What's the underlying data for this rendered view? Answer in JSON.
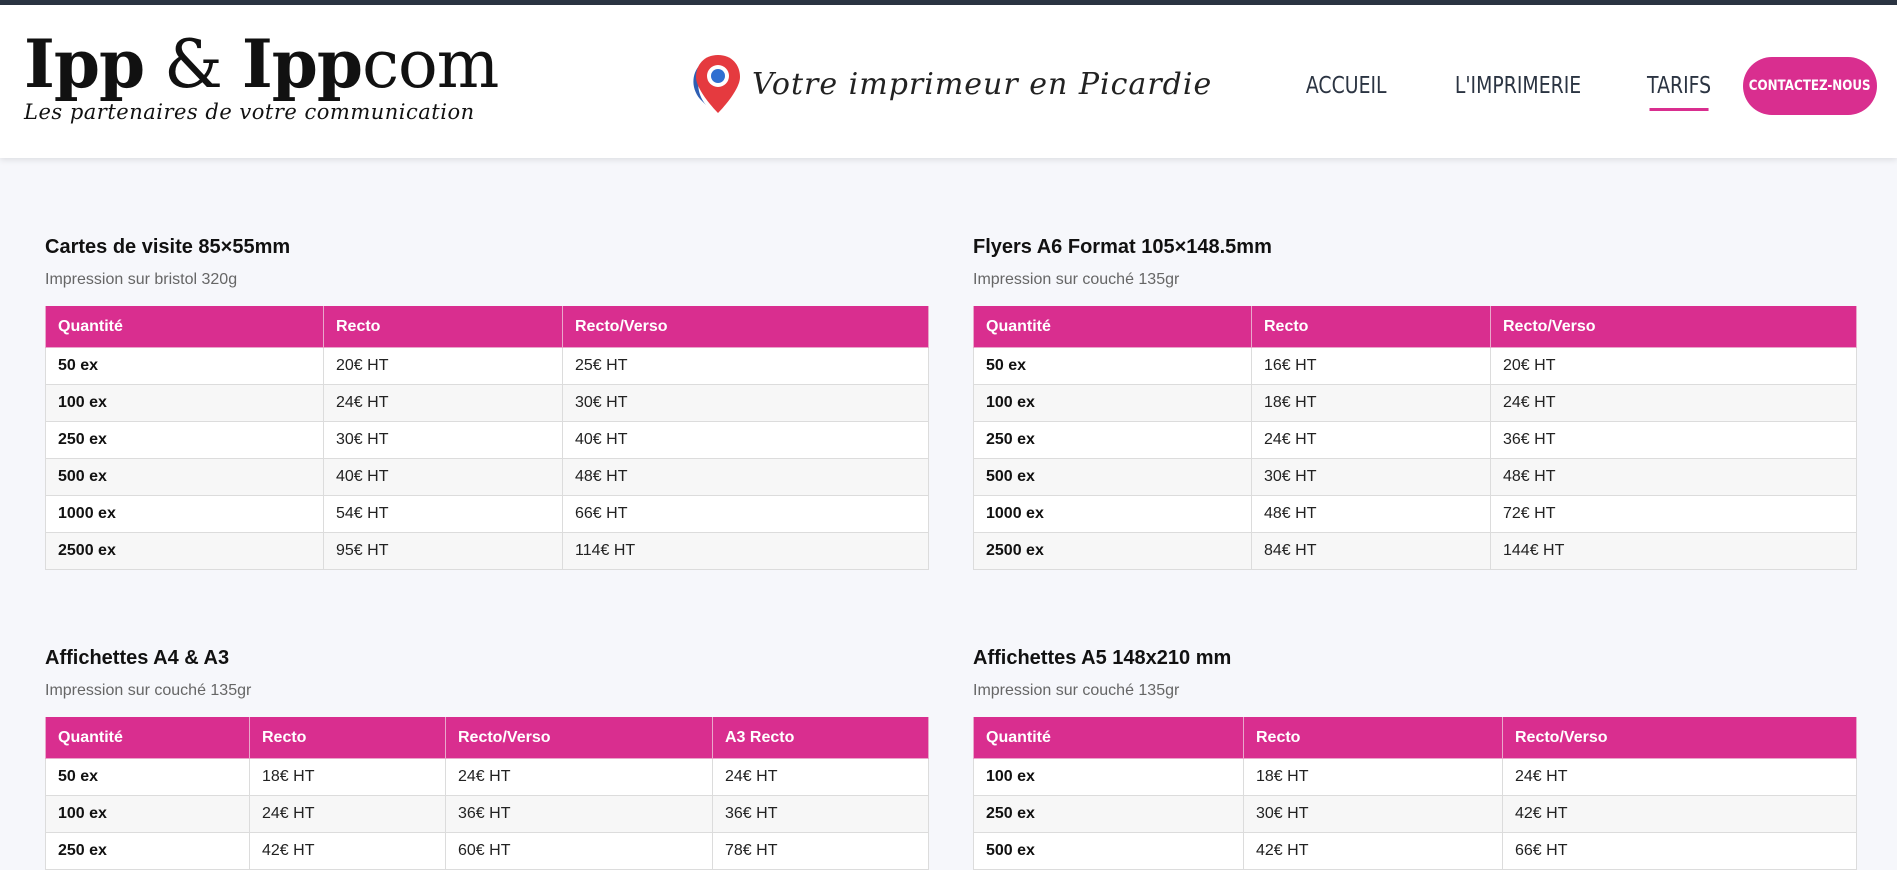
{
  "header": {
    "logo_ipp": "Ipp",
    "logo_amp": "&",
    "logo_ippcom_ipp": "Ipp",
    "logo_ippcom_com": "com",
    "logo_tagline": "Les partenaires de votre communication",
    "slogan": "Votre imprimeur en Picardie",
    "nav": [
      "ACCUEIL",
      "L'IMPRIMERIE",
      "TARIFS"
    ],
    "active_nav": "TARIFS",
    "cta": "CONTACTEZ-NOUS",
    "accent_color": "#d92e8f",
    "icons": {
      "pin": "location-pin-icon"
    }
  },
  "sections": [
    {
      "title": "Cartes de visite 85×55mm",
      "subtitle": "Impression sur bristol 320g",
      "headers": [
        "Quantité",
        "Recto",
        "Recto/Verso"
      ],
      "rows": [
        [
          "50 ex",
          "20€ HT",
          "25€ HT"
        ],
        [
          "100 ex",
          "24€ HT",
          "30€ HT"
        ],
        [
          "250 ex",
          "30€ HT",
          "40€ HT"
        ],
        [
          "500 ex",
          "40€ HT",
          "48€ HT"
        ],
        [
          "1000 ex",
          "54€ HT",
          "66€ HT"
        ],
        [
          "2500 ex",
          "95€ HT",
          "114€ HT"
        ]
      ]
    },
    {
      "title": "Flyers A6 Format 105×148.5mm",
      "subtitle": "Impression sur couché 135gr",
      "headers": [
        "Quantité",
        "Recto",
        "Recto/Verso"
      ],
      "rows": [
        [
          "50 ex",
          "16€ HT",
          "20€ HT"
        ],
        [
          "100 ex",
          "18€ HT",
          "24€ HT"
        ],
        [
          "250 ex",
          "24€ HT",
          "36€ HT"
        ],
        [
          "500 ex",
          "30€ HT",
          "48€ HT"
        ],
        [
          "1000 ex",
          "48€ HT",
          "72€ HT"
        ],
        [
          "2500 ex",
          "84€ HT",
          "144€ HT"
        ]
      ]
    },
    {
      "title": "Affichettes A4 & A3",
      "subtitle": "Impression sur couché 135gr",
      "headers": [
        "Quantité",
        "Recto",
        "Recto/Verso",
        "A3 Recto"
      ],
      "rows": [
        [
          "50 ex",
          "18€ HT",
          "24€ HT",
          "24€ HT"
        ],
        [
          "100 ex",
          "24€ HT",
          "36€ HT",
          "36€ HT"
        ],
        [
          "250 ex",
          "42€ HT",
          "60€ HT",
          "78€ HT"
        ]
      ]
    },
    {
      "title": "Affichettes A5 148x210 mm",
      "subtitle": "Impression sur couché 135gr",
      "headers": [
        "Quantité",
        "Recto",
        "Recto/Verso"
      ],
      "rows": [
        [
          "100 ex",
          "18€ HT",
          "24€ HT"
        ],
        [
          "250 ex",
          "30€ HT",
          "42€ HT"
        ],
        [
          "500 ex",
          "42€ HT",
          "66€ HT"
        ]
      ]
    }
  ]
}
